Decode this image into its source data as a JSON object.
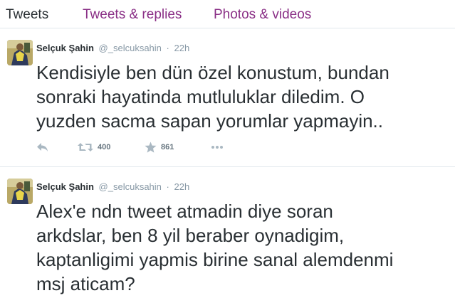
{
  "tabs": [
    {
      "label": "Tweets",
      "active": true
    },
    {
      "label": "Tweets & replies",
      "active": false
    },
    {
      "label": "Photos & videos",
      "active": false
    }
  ],
  "colors": {
    "link_tab": "#8a2f86",
    "meta_gray": "#8899a6",
    "action_gray": "#aab8c2",
    "text": "#292f33",
    "divider": "#e1e8ed"
  },
  "tweets": [
    {
      "fullname": "Selçuk Şahin",
      "username": "@_selcuksahin",
      "separator": "·",
      "time": "22h",
      "lines": [
        "Kendisiyle ben dün özel konustum, bundan",
        "sonraki hayatinda mutluluklar diledim. O",
        "yuzden sacma sapan yorumlar yapmayin.."
      ],
      "retweets": "400",
      "favorites": "861",
      "icons": {
        "reply": "reply-icon",
        "retweet": "retweet-icon",
        "favorite": "star-icon",
        "more": "more-dots-icon"
      }
    },
    {
      "fullname": "Selçuk Şahin",
      "username": "@_selcuksahin",
      "separator": "·",
      "time": "22h",
      "lines": [
        "Alex'e ndn tweet atmadin diye soran",
        "arkdslar, ben 8 yil beraber oynadigim,",
        "kaptanligimi yapmis birine sanal alemdenmi",
        "msj aticam?"
      ]
    }
  ]
}
